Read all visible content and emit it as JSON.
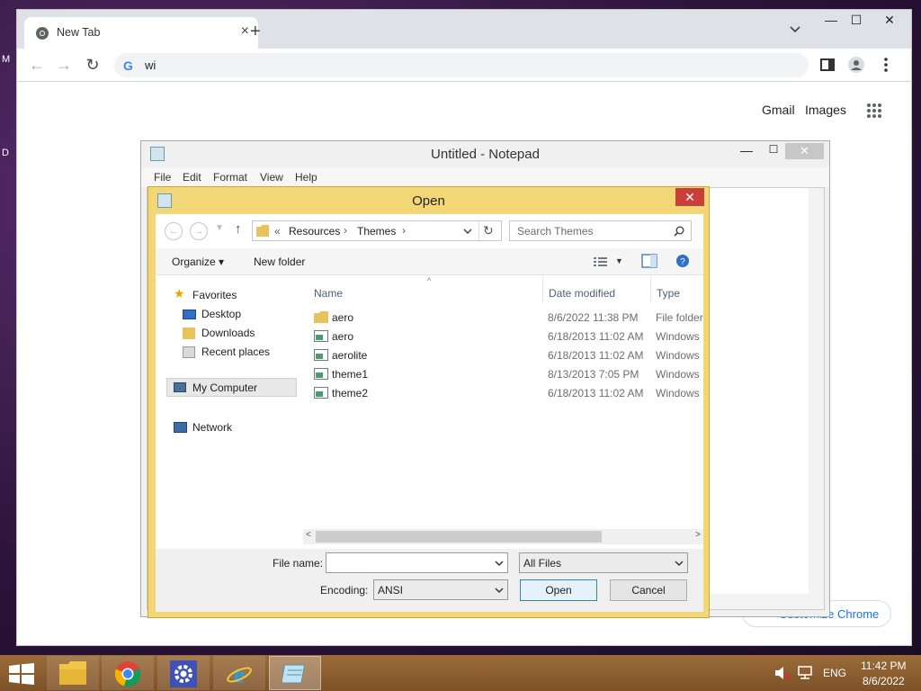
{
  "desktop": {
    "frag1": "M",
    "frag2": "D"
  },
  "chrome": {
    "tab_title": "New Tab",
    "tab_close": "×",
    "new_tab": "+",
    "omnibox_text": "wi",
    "omnibox_g": "G",
    "gmail": "Gmail",
    "images": "Images",
    "customize": "Customize Chrome",
    "win_min": "—",
    "win_max": "☐",
    "win_close": "✕"
  },
  "notepad": {
    "title": "Untitled - Notepad",
    "menu": [
      "File",
      "Edit",
      "Format",
      "View",
      "Help"
    ]
  },
  "dialog": {
    "title": "Open",
    "close": "✕",
    "breadcrumb": {
      "prefix": "«",
      "items": [
        "Resources",
        "Themes"
      ]
    },
    "search_placeholder": "Search Themes",
    "organize": "Organize",
    "new_folder": "New folder",
    "nav": {
      "favorites": "Favorites",
      "desktop": "Desktop",
      "downloads": "Downloads",
      "recent": "Recent places",
      "computer": "My Computer",
      "network": "Network"
    },
    "columns": {
      "name": "Name",
      "date": "Date modified",
      "type": "Type"
    },
    "files": [
      {
        "name": "aero",
        "date": "8/6/2022 11:38 PM",
        "type": "File folder",
        "icon": "folder-icon"
      },
      {
        "name": "aero",
        "date": "6/18/2013 11:02 AM",
        "type": "Windows",
        "icon": "theme-file-icon"
      },
      {
        "name": "aerolite",
        "date": "6/18/2013 11:02 AM",
        "type": "Windows",
        "icon": "theme-file-icon"
      },
      {
        "name": "theme1",
        "date": "8/13/2013 7:05 PM",
        "type": "Windows",
        "icon": "theme-file-icon"
      },
      {
        "name": "theme2",
        "date": "6/18/2013 11:02 AM",
        "type": "Windows",
        "icon": "theme-file-icon"
      }
    ],
    "file_name_label": "File name:",
    "file_name_value": "",
    "filter": "All Files",
    "encoding_label": "Encoding:",
    "encoding_value": "ANSI",
    "open_btn": "Open",
    "cancel_btn": "Cancel"
  },
  "taskbar": {
    "apps": [
      "file-explorer",
      "chrome",
      "settings",
      "internet-explorer",
      "notepad"
    ],
    "lang": "ENG",
    "time": "11:42 PM",
    "date": "8/6/2022"
  }
}
